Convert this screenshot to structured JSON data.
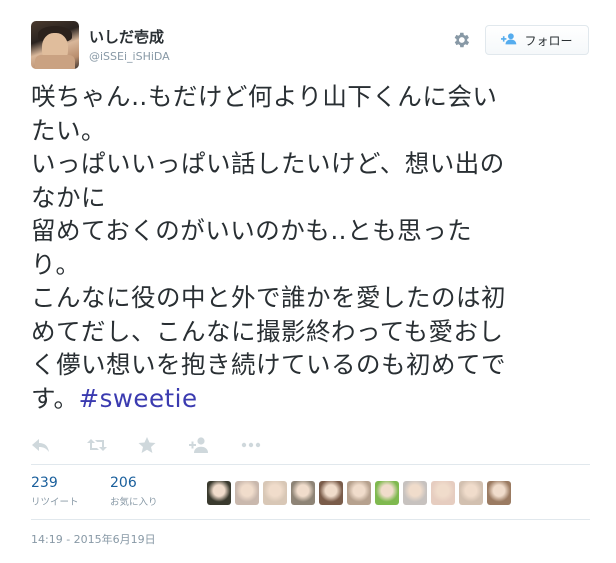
{
  "user": {
    "display_name": "いしだ壱成",
    "handle": "@iSSEi_iSHiDA"
  },
  "follow_button": {
    "label": "フォロー"
  },
  "icons": {
    "settings": "gear-icon",
    "follow": "add-user-icon",
    "reply": "reply-icon",
    "retweet": "retweet-icon",
    "favorite": "star-icon",
    "follow_small": "add-user-icon",
    "more": "more-icon"
  },
  "tweet": {
    "lines": [
      "咲ちゃん‥もだけど何より山下くんに会い",
      "たい。",
      "いっぱいいっぱい話したいけど、想い出の",
      "なかに",
      "留めておくのがいいのかも‥とも思った",
      "り。",
      "こんなに役の中と外で誰かを愛したのは初",
      "めてだし、こんなに撮影終わっても愛おし",
      "く儚い想いを抱き続けているのも初めてで",
      "す。"
    ],
    "hashtag": "#sweetie"
  },
  "stats": {
    "retweets": {
      "count": "239",
      "label": "リツイート"
    },
    "favorites": {
      "count": "206",
      "label": "お気に入り"
    }
  },
  "favoriters": [
    {
      "color": "#3a3a2e"
    },
    {
      "color": "#c9b8ad"
    },
    {
      "color": "#d8c7b6"
    },
    {
      "color": "#8e8476"
    },
    {
      "color": "#7a5c4a"
    },
    {
      "color": "#b6a18e"
    },
    {
      "color": "#7fb94f"
    },
    {
      "color": "#c7c2bf"
    },
    {
      "color": "#e6cdc0"
    },
    {
      "color": "#d2c0b0"
    },
    {
      "color": "#9b7b62"
    }
  ],
  "timestamp": "14:19 - 2015年6月19日"
}
